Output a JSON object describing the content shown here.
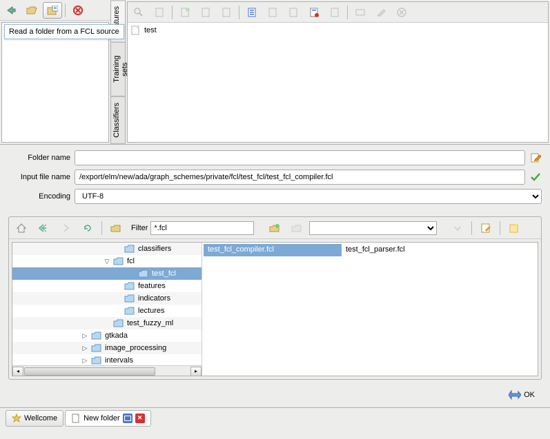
{
  "tooltip": "Read a folder from a FCL source",
  "vtabs": [
    "Features",
    "Training sets",
    "Classifiers"
  ],
  "tree_root": "test",
  "form": {
    "folder_label": "Folder name",
    "folder_value": "",
    "input_label": "Input file name",
    "input_value": "/export/elm/new/ada/graph_schemes/private/fcl/test_fcl/test_fcl_compiler.fcl",
    "encoding_label": "Encoding",
    "encoding_value": "UTF-8"
  },
  "browser": {
    "filter_label": "Filter",
    "filter_value": "*.fcl"
  },
  "tree": [
    {
      "indent": 140,
      "expander": "",
      "name": "classifiers",
      "selected": false
    },
    {
      "indent": 124,
      "expander": "▽",
      "name": "fcl",
      "selected": false
    },
    {
      "indent": 160,
      "expander": "",
      "name": "test_fcl",
      "selected": true
    },
    {
      "indent": 140,
      "expander": "",
      "name": "features",
      "selected": false
    },
    {
      "indent": 140,
      "expander": "",
      "name": "indicators",
      "selected": false
    },
    {
      "indent": 140,
      "expander": "",
      "name": "lectures",
      "selected": false
    },
    {
      "indent": 124,
      "expander": "",
      "name": "test_fuzzy_ml",
      "selected": false
    },
    {
      "indent": 92,
      "expander": "▷",
      "name": "gtkada",
      "selected": false
    },
    {
      "indent": 92,
      "expander": "▷",
      "name": "image_processing",
      "selected": false
    },
    {
      "indent": 92,
      "expander": "▷",
      "name": "intervals",
      "selected": false
    }
  ],
  "files": [
    {
      "name": "test_fcl_compiler.fcl",
      "selected": true
    },
    {
      "name": "test_fcl_parser.fcl",
      "selected": false
    }
  ],
  "ok_label": "OK",
  "tabs": [
    {
      "label": "Wellcome",
      "closable": false
    },
    {
      "label": "New folder",
      "closable": true
    }
  ]
}
